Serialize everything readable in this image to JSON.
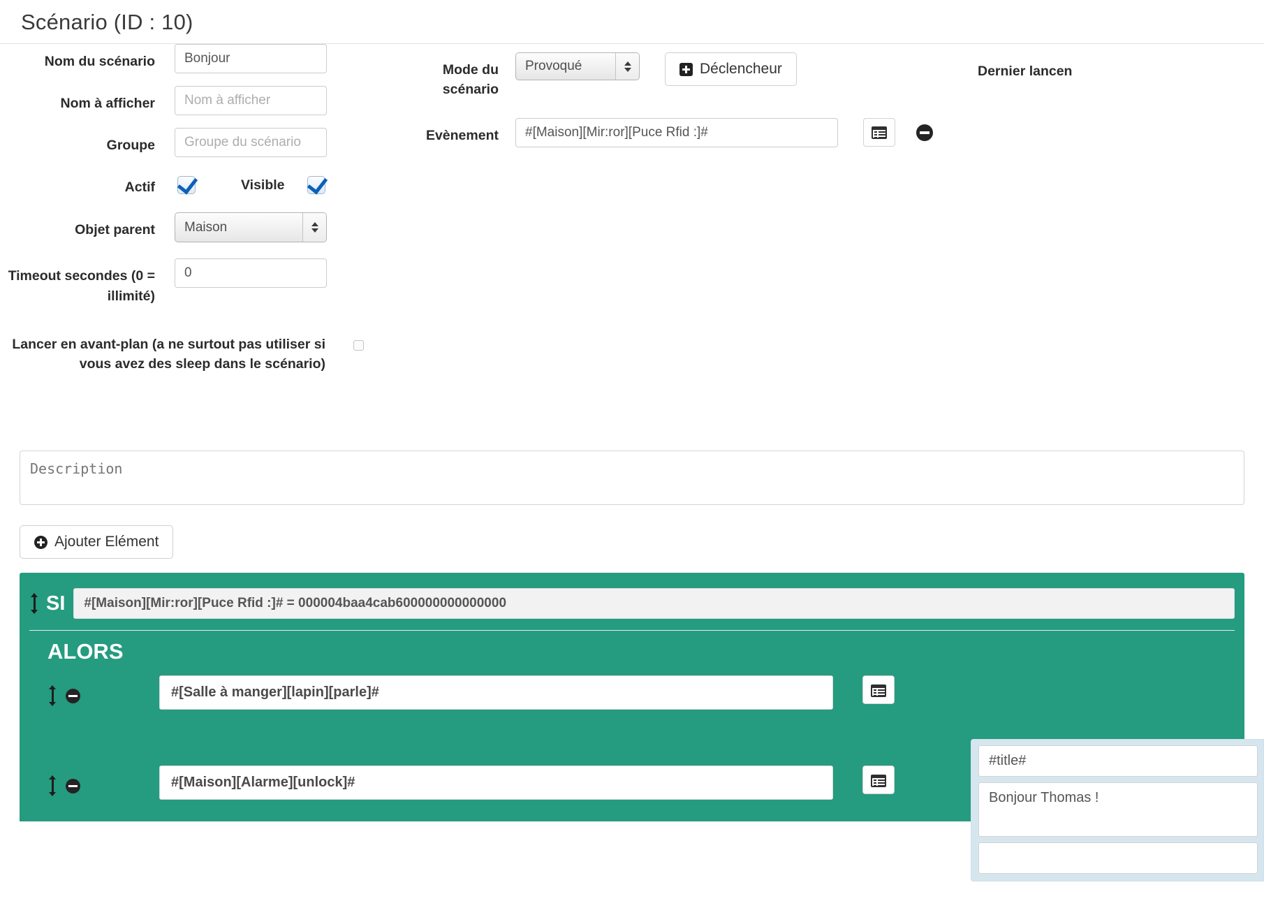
{
  "header": {
    "title": "Scénario (ID : 10)"
  },
  "form": {
    "scenario_name": {
      "label": "Nom du scénario",
      "value": "Bonjour",
      "placeholder": "Nom du scénario"
    },
    "display_name": {
      "label": "Nom à afficher",
      "value": "",
      "placeholder": "Nom à afficher"
    },
    "group": {
      "label": "Groupe",
      "value": "",
      "placeholder": "Groupe du scénario"
    },
    "active": {
      "label": "Actif",
      "checked": true
    },
    "visible": {
      "label": "Visible",
      "checked": true
    },
    "parent_object": {
      "label": "Objet parent",
      "value": "Maison",
      "options": [
        "Maison"
      ]
    },
    "timeout": {
      "label": "Timeout secondes (0 = illimité)",
      "value": "0",
      "placeholder": "0"
    },
    "foreground": {
      "label": "Lancer en avant-plan (a ne surtout pas utiliser si vous avez des sleep dans le scénario)",
      "checked": false
    },
    "mode": {
      "label": "Mode du scénario",
      "value": "Provoqué",
      "options": [
        "Provoqué"
      ]
    },
    "trigger_button": {
      "label": "Déclencheur",
      "icon": "plus-square-icon"
    },
    "event": {
      "label": "Evènement",
      "value": "#[Maison][Mir:ror][Puce Rfid :]#",
      "list_icon": "list-alt-icon",
      "remove_icon": "minus-circle-icon"
    },
    "last_launch": {
      "label": "Dernier lancen"
    },
    "description": {
      "placeholder": "Description",
      "value": ""
    }
  },
  "toolbar": {
    "add_element": {
      "label": "Ajouter Elément",
      "icon": "plus-circle-icon"
    }
  },
  "scenario": {
    "if_keyword": "SI",
    "if_condition": "#[Maison][Mir:ror][Puce Rfid :]# = 000004baa4cab600000000000000",
    "then_keyword": "ALORS",
    "actions": [
      {
        "value": "#[Salle à manger][lapin][parle]#",
        "drag_icon": "drag-vertical-icon",
        "remove_icon": "minus-circle-icon",
        "list_icon": "list-alt-icon"
      },
      {
        "value": "#[Maison][Alarme][unlock]#",
        "drag_icon": "drag-vertical-icon",
        "remove_icon": "minus-circle-icon",
        "list_icon": "list-alt-icon"
      }
    ],
    "params_panel": {
      "title_field": {
        "value": "#title#",
        "placeholder": ""
      },
      "message_field": {
        "value": "Bonjour Thomas !",
        "placeholder": ""
      },
      "extra_field": {
        "value": "",
        "placeholder": ""
      }
    }
  },
  "colors": {
    "scenario_green": "#259b80",
    "param_panel_blue": "#d6e6ef",
    "checkbox_blue": "#0b61b9"
  }
}
